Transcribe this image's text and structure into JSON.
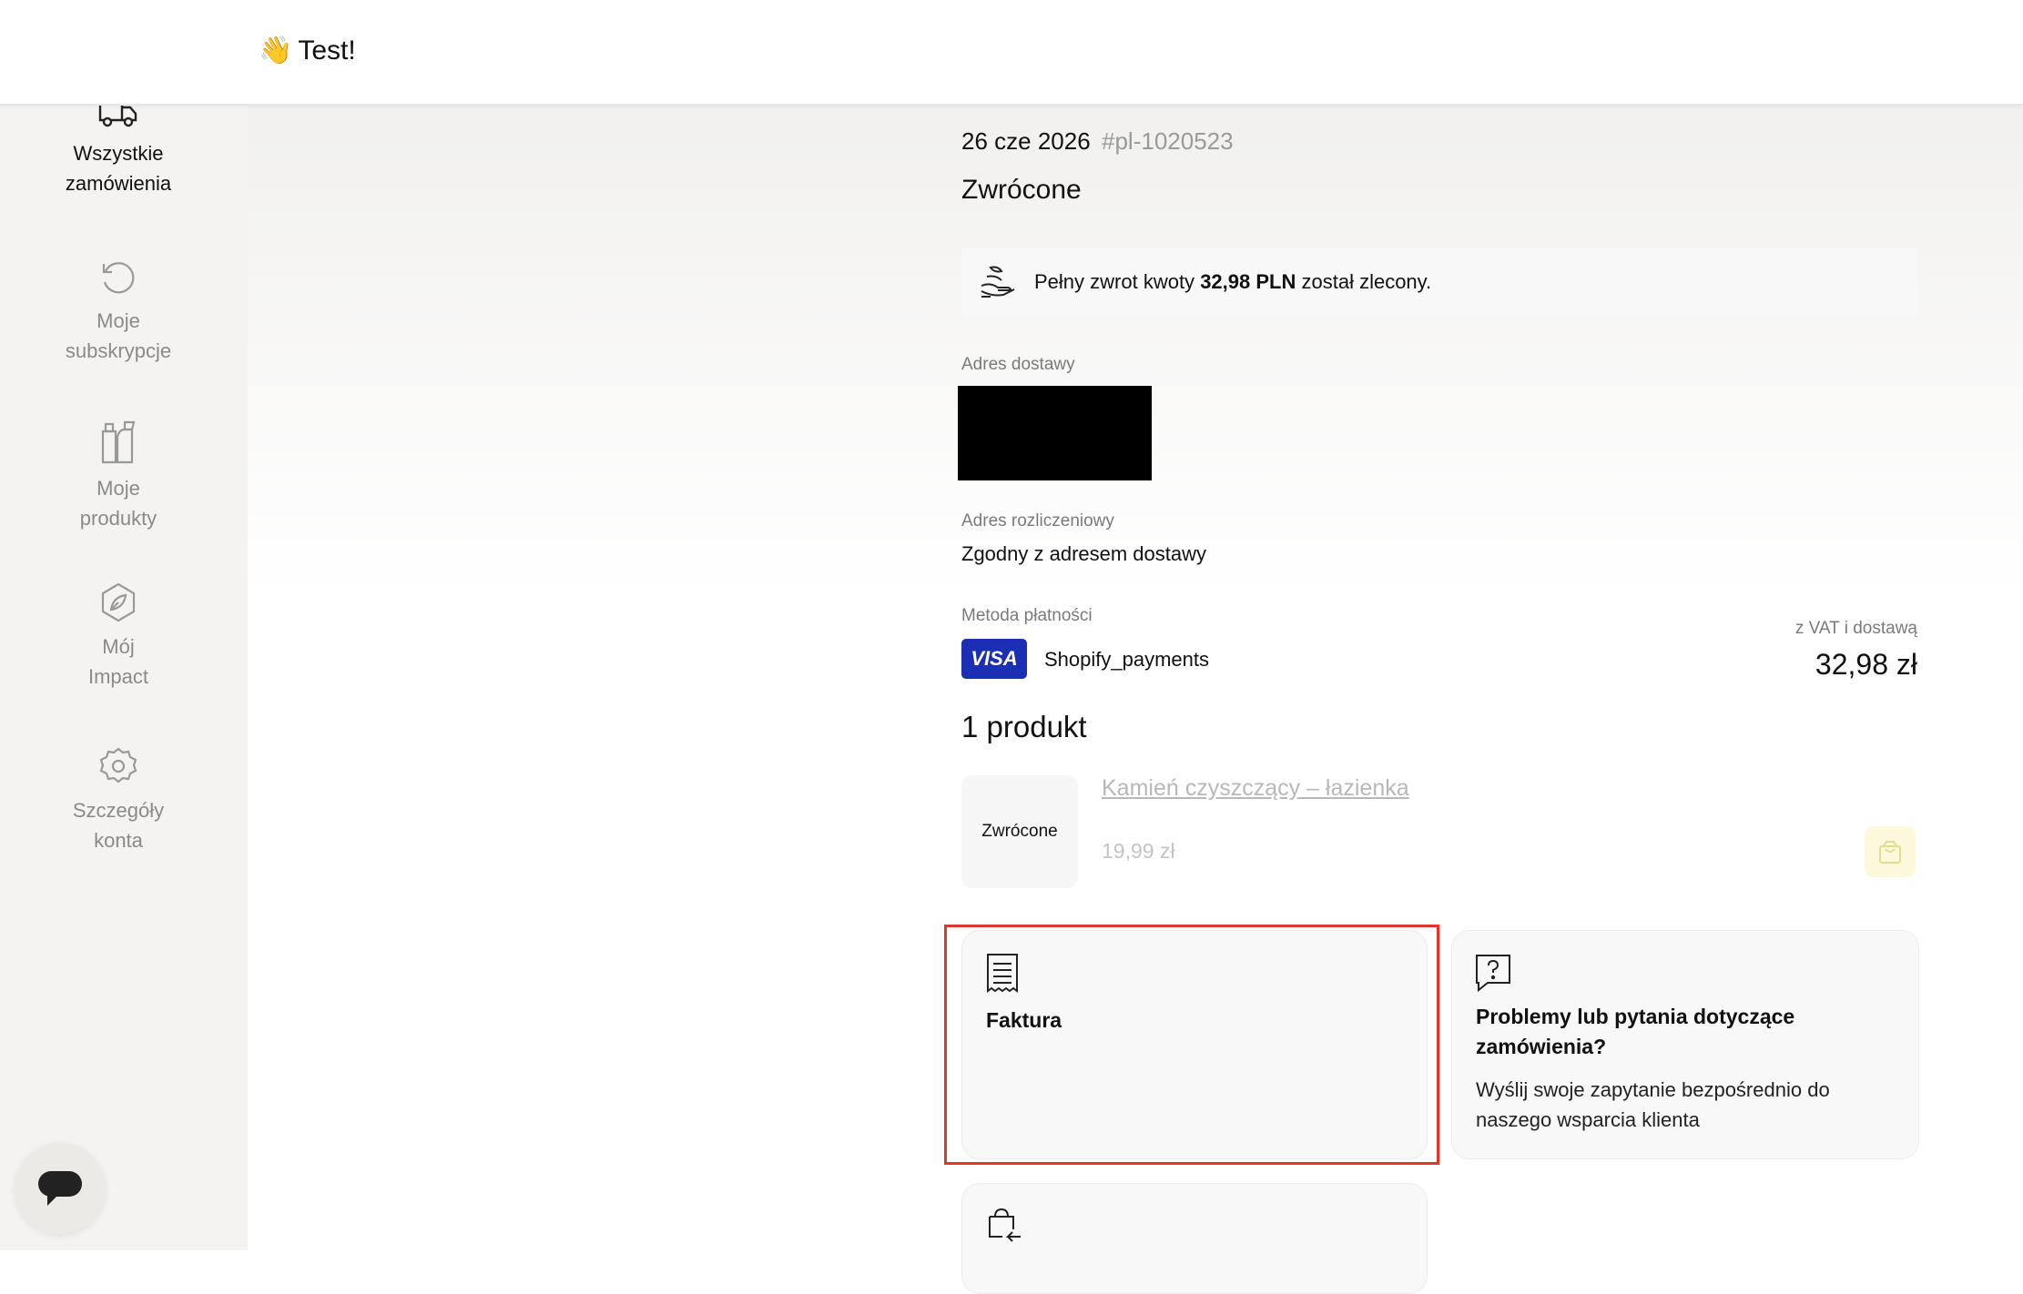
{
  "header": {
    "greeting_emoji": "👋",
    "greeting": "Test!"
  },
  "sidebar": {
    "items": [
      {
        "label": "Wszystkie zamówienia",
        "line1": "Wszystkie",
        "line2": "zamówienia",
        "icon": "truck-icon",
        "active": true
      },
      {
        "label": "Moje subskrypcje",
        "line1": "Moje",
        "line2": "subskrypcje",
        "icon": "refresh-icon",
        "active": false
      },
      {
        "label": "Moje produkty",
        "line1": "Moje",
        "line2": "produkty",
        "icon": "bottles-icon",
        "active": false
      },
      {
        "label": "Mój Impact",
        "line1": "Mój",
        "line2": "Impact",
        "icon": "leaf-icon",
        "active": false
      },
      {
        "label": "Szczegóły konta",
        "line1": "Szczegóły",
        "line2": "konta",
        "icon": "gear-icon",
        "active": false
      }
    ]
  },
  "order": {
    "date": "26 cze 2026",
    "id": "#pl-1020523",
    "status": "Zwrócone",
    "refund": {
      "prefix": "Pełny zwrot kwoty",
      "amount": "32,98 PLN",
      "suffix": "został zlecony."
    },
    "shipping_label": "Adres dostawy",
    "billing_label": "Adres rozliczeniowy",
    "billing_value": "Zgodny z adresem dostawy",
    "payment_label": "Metoda płatności",
    "payment_brand": "VISA",
    "payment_value": "Shopify_payments",
    "total_note": "z VAT i dostawą",
    "total": "32,98 zł",
    "products_heading": "1 produkt",
    "product": {
      "status": "Zwrócone",
      "name": "Kamień czyszczący – łazienka",
      "price": "19,99 zł"
    }
  },
  "cards": {
    "invoice": {
      "title": "Faktura"
    },
    "support": {
      "title": "Problemy lub pytania dotyczące zamówienia?",
      "text": "Wyślij swoje zapytanie bezpośrednio do naszego wsparcia klienta"
    }
  },
  "colors": {
    "visa": "#1a2fb3",
    "highlight": "#e2362b",
    "sidebar_bg": "#f4f3f1"
  }
}
